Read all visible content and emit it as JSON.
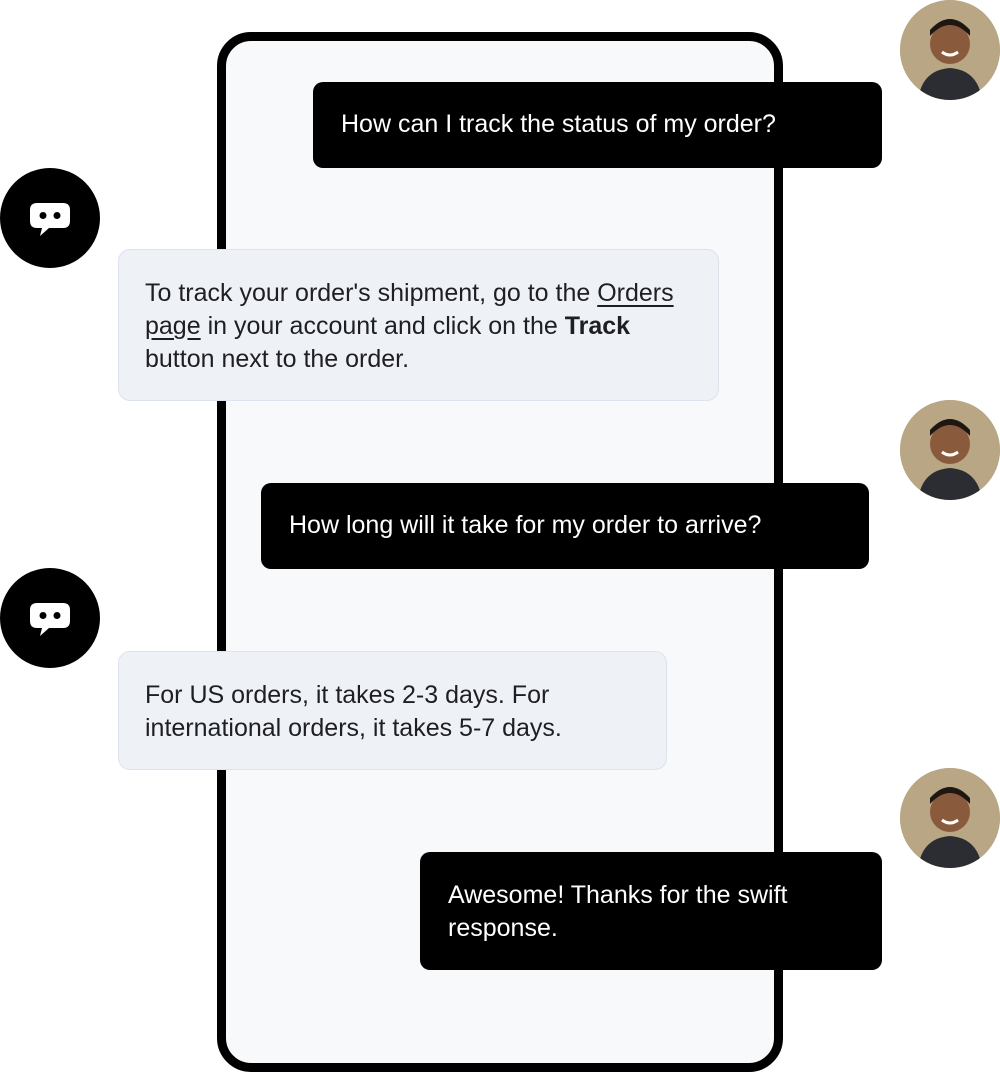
{
  "messages": [
    {
      "role": "user",
      "text": "How can I track the status of my order?"
    },
    {
      "role": "bot",
      "parts": {
        "p1": "To track your order's shipment, go to the ",
        "link": "Orders page",
        "p2": " in your account and click on the ",
        "bold": "Track",
        "p3": " button next to the order."
      }
    },
    {
      "role": "user",
      "text": "How long will it take for my order to arrive?"
    },
    {
      "role": "bot",
      "text": "For US orders, it takes 2-3 days. For international orders, it takes 5-7 days."
    },
    {
      "role": "user",
      "text": "Awesome! Thanks for the swift response."
    }
  ],
  "icons": {
    "bot": "chatbot-icon",
    "user": "user-avatar"
  },
  "colors": {
    "user_bubble": "#000000",
    "bot_bubble": "#eef2f7",
    "phone_frame": "#000000"
  }
}
